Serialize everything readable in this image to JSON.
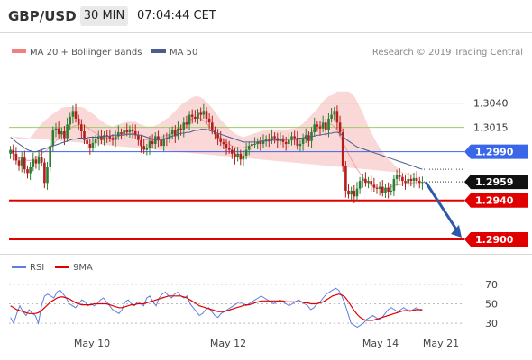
{
  "header": {
    "pair": "GBP/USD",
    "timeframe": "30 MIN",
    "time": "07:04:44 CET"
  },
  "legend": {
    "bollinger_label": "MA 20 + Bollinger Bands",
    "ma50_label": "MA 50",
    "copyright": "Research © 2019 Trading Central",
    "rsi_label": "RSI",
    "rsi_ma_label": "9MA"
  },
  "colors": {
    "bull": "#2e7d32",
    "bear": "#b71c1c",
    "band_fill": "#fad4d4",
    "band_line": "#f08080",
    "ma50": "#4a5e8c",
    "support": "#e00000",
    "pivot": "#3a66e8",
    "resistance": "#9ccc65",
    "last_price": "#111111",
    "rsi": "#5b7fe0",
    "rsi_ma": "#e00000"
  },
  "chart_data": [
    {
      "type": "candlestick",
      "title": "GBP/USD",
      "timeframe": "30 MIN",
      "x_ticks": [
        "May 10",
        "May 12",
        "May 14",
        "May 21"
      ],
      "ylim": [
        1.2887,
        1.3085
      ],
      "levels": [
        {
          "value": 1.304,
          "label": "1.3040",
          "kind": "resistance"
        },
        {
          "value": 1.3015,
          "label": "1.3015",
          "kind": "resistance"
        },
        {
          "value": 1.299,
          "label": "1.2990",
          "kind": "pivot"
        },
        {
          "value": 1.2959,
          "label": "1.2959",
          "kind": "last"
        },
        {
          "value": 1.294,
          "label": "1.2940",
          "kind": "support"
        },
        {
          "value": 1.29,
          "label": "1.2900",
          "kind": "support"
        }
      ],
      "forecast": {
        "from": 1.2959,
        "to": 1.29
      },
      "close_series": [
        1.2992,
        1.2988,
        1.2981,
        1.2976,
        1.2984,
        1.2972,
        1.2968,
        1.2974,
        1.2982,
        1.2978,
        1.2985,
        1.2979,
        1.2958,
        1.2974,
        1.2996,
        1.3012,
        1.3014,
        1.3008,
        1.3011,
        1.3004,
        1.3018,
        1.3026,
        1.3032,
        1.3024,
        1.3018,
        1.3011,
        1.3002,
        1.2998,
        1.2994,
        1.2999,
        1.3003,
        1.3006,
        1.3002,
        1.3007,
        1.3006,
        1.3004,
        1.3002,
        1.3006,
        1.301,
        1.3008,
        1.3012,
        1.301,
        1.3013,
        1.3011,
        1.3007,
        1.3002,
        1.2996,
        1.2992,
        1.2994,
        1.3001,
        1.2998,
        1.3006,
        1.3002,
        1.2996,
        1.3004,
        1.3003,
        1.3008,
        1.3012,
        1.3006,
        1.3014,
        1.3012,
        1.302,
        1.3018,
        1.3028,
        1.3026,
        1.3024,
        1.303,
        1.3028,
        1.3032,
        1.3024,
        1.302,
        1.3012,
        1.3008,
        1.3004,
        1.3,
        1.2998,
        1.2994,
        1.2992,
        1.2988,
        1.2984,
        1.2988,
        1.2982,
        1.2986,
        1.2992,
        1.2996,
        1.2998,
        1.2998,
        1.3,
        1.2998,
        1.3001,
        1.3003,
        1.3002,
        1.3006,
        1.3004,
        1.3001,
        1.3003,
        1.3,
        1.2998,
        1.3002,
        1.3006,
        1.3004,
        1.2996,
        1.2998,
        1.3003,
        1.3007,
        1.3001,
        1.301,
        1.3018,
        1.3016,
        1.3014,
        1.302,
        1.3012,
        1.3024,
        1.3028,
        1.3032,
        1.302,
        1.301,
        1.2975,
        1.295,
        1.2946,
        1.295,
        1.2944,
        1.2952,
        1.296,
        1.2962,
        1.2958,
        1.296,
        1.2956,
        1.2953,
        1.2952,
        1.2954,
        1.2948,
        1.2953,
        1.2949,
        1.295,
        1.2962,
        1.2966,
        1.2964,
        1.296,
        1.2958,
        1.2962,
        1.296,
        1.2963,
        1.296,
        1.2958,
        1.2959
      ],
      "ma50_series": [
        1.3005,
        1.3003,
        1.3,
        1.2998,
        1.2996,
        1.2994,
        1.2992,
        1.2991,
        1.299,
        1.299,
        1.2991,
        1.2992,
        1.2993,
        1.2994,
        1.2995,
        1.2996,
        1.2997,
        1.2998,
        1.2999,
        1.3,
        1.3001,
        1.3002,
        1.3003,
        1.3003,
        1.3004,
        1.3004,
        1.3004,
        1.3004,
        1.3005,
        1.3005,
        1.3005,
        1.3005,
        1.3006,
        1.3006,
        1.3006,
        1.3006,
        1.3007,
        1.3007,
        1.3007,
        1.3007,
        1.3007,
        1.3008,
        1.3008,
        1.3008,
        1.3008,
        1.3007,
        1.3007,
        1.3006,
        1.3005,
        1.3004,
        1.3003,
        1.3002,
        1.3002,
        1.3002,
        1.3003,
        1.3004,
        1.3005,
        1.3006,
        1.3007,
        1.3008,
        1.3009,
        1.3009,
        1.301,
        1.301,
        1.3011,
        1.3012,
        1.3012,
        1.3013,
        1.3013,
        1.3013,
        1.3012,
        1.3011,
        1.301,
        1.3009,
        1.3008,
        1.3007,
        1.3006,
        1.3005,
        1.3004,
        1.3003,
        1.3002,
        1.3001,
        1.3,
        1.3,
        1.3,
        1.3,
        1.3,
        1.3,
        1.3001,
        1.3001,
        1.3001,
        1.3001,
        1.3002,
        1.3002,
        1.3002,
        1.3002,
        1.3003,
        1.3003,
        1.3003,
        1.3003,
        1.3003,
        1.3004,
        1.3004,
        1.3004,
        1.3005,
        1.3005,
        1.3006,
        1.3006,
        1.3007,
        1.3007,
        1.3008,
        1.3008,
        1.3009,
        1.3009,
        1.301,
        1.301,
        1.3009,
        1.3006,
        1.3003,
        1.3001,
        1.2999,
        1.2997,
        1.2995,
        1.2994,
        1.2993,
        1.2992,
        1.2991,
        1.299,
        1.2989,
        1.2988,
        1.2987,
        1.2986,
        1.2985,
        1.2984,
        1.2983,
        1.2982,
        1.2981,
        1.298,
        1.2979,
        1.2978,
        1.2977,
        1.2976,
        1.2975,
        1.2974,
        1.2973,
        1.2972
      ],
      "bb_mid_series": [
        1.299,
        1.2988,
        1.2986,
        1.2984,
        1.2983,
        1.2982,
        1.2981,
        1.2981,
        1.2982,
        1.2984,
        1.2986,
        1.2988,
        1.299,
        1.2992,
        1.2995,
        1.2998,
        1.3001,
        1.3004,
        1.3007,
        1.301,
        1.3012,
        1.3014,
        1.3016,
        1.3017,
        1.3018,
        1.3018,
        1.3017,
        1.3015,
        1.3013,
        1.3011,
        1.3009,
        1.3007,
        1.3006,
        1.3005,
        1.3004,
        1.3004,
        1.3004,
        1.3005,
        1.3006,
        1.3007,
        1.3008,
        1.3009,
        1.3009,
        1.3009,
        1.3008,
        1.3006,
        1.3004,
        1.3003,
        1.3002,
        1.3002,
        1.3002,
        1.3003,
        1.3004,
        1.3005,
        1.3006,
        1.3007,
        1.3008,
        1.301,
        1.3012,
        1.3014,
        1.3016,
        1.3018,
        1.302,
        1.3022,
        1.3024,
        1.3025,
        1.3025,
        1.3024,
        1.3022,
        1.3019,
        1.3016,
        1.3013,
        1.301,
        1.3007,
        1.3004,
        1.3002,
        1.3,
        1.2998,
        1.2996,
        1.2995,
        1.2994,
        1.2994,
        1.2994,
        1.2995,
        1.2996,
        1.2997,
        1.2998,
        1.2999,
        1.3,
        1.3001,
        1.3001,
        1.3002,
        1.3002,
        1.3002,
        1.3002,
        1.3002,
        1.3002,
        1.3002,
        1.3002,
        1.3002,
        1.3002,
        1.3002,
        1.3003,
        1.3004,
        1.3006,
        1.3008,
        1.301,
        1.3012,
        1.3014,
        1.3016,
        1.3018,
        1.3019,
        1.3019,
        1.3018,
        1.3016,
        1.3012,
        1.3006,
        1.3,
        1.2994,
        1.2988,
        1.2982,
        1.2977,
        1.2972,
        1.2968,
        1.2964,
        1.2961,
        1.2958,
        1.2956,
        1.2954,
        1.2953,
        1.2952,
        1.2952,
        1.2952,
        1.2953,
        1.2954,
        1.2955,
        1.2956,
        1.2956,
        1.2957,
        1.2957,
        1.2958,
        1.2958,
        1.2958,
        1.2959
      ],
      "bb_width_series": [
        0.0016,
        0.0017,
        0.0018,
        0.0019,
        0.002,
        0.0021,
        0.0022,
        0.0024,
        0.0026,
        0.0028,
        0.003,
        0.0031,
        0.0032,
        0.0032,
        0.0032,
        0.0031,
        0.003,
        0.0029,
        0.0028,
        0.0026,
        0.0024,
        0.0022,
        0.002,
        0.0019,
        0.0018,
        0.0018,
        0.0018,
        0.0018,
        0.0018,
        0.0018,
        0.0018,
        0.0017,
        0.0016,
        0.0015,
        0.0014,
        0.0013,
        0.0012,
        0.0012,
        0.0012,
        0.0012,
        0.0012,
        0.0012,
        0.0012,
        0.0012,
        0.0013,
        0.0013,
        0.0014,
        0.0014,
        0.0014,
        0.0014,
        0.0014,
        0.0014,
        0.0014,
        0.0015,
        0.0016,
        0.0017,
        0.0018,
        0.0019,
        0.002,
        0.0021,
        0.0022,
        0.0022,
        0.0022,
        0.0022,
        0.0022,
        0.0022,
        0.0022,
        0.0022,
        0.0022,
        0.0022,
        0.0022,
        0.0022,
        0.0021,
        0.002,
        0.0019,
        0.0018,
        0.0017,
        0.0016,
        0.0015,
        0.0014,
        0.0013,
        0.0012,
        0.0011,
        0.0011,
        0.0011,
        0.0011,
        0.0011,
        0.0011,
        0.0011,
        0.0011,
        0.0011,
        0.0011,
        0.0011,
        0.0011,
        0.0011,
        0.0011,
        0.0011,
        0.0011,
        0.0011,
        0.0012,
        0.0012,
        0.0013,
        0.0014,
        0.0015,
        0.0016,
        0.0017,
        0.0018,
        0.0019,
        0.002,
        0.0022,
        0.0024,
        0.0026,
        0.0028,
        0.003,
        0.0034,
        0.004,
        0.0046,
        0.0052,
        0.0058,
        0.0064,
        0.0068,
        0.007,
        0.007,
        0.0068,
        0.0066,
        0.0062,
        0.0058,
        0.0054,
        0.005,
        0.0046,
        0.0042,
        0.0038,
        0.0034,
        0.003,
        0.0026,
        0.0022,
        0.0018,
        0.0015,
        0.0012,
        0.001,
        0.0008,
        0.0008,
        0.0008,
        0.0008
      ]
    },
    {
      "type": "line",
      "title": "RSI",
      "yticks": [
        70,
        50,
        30
      ],
      "ylim": [
        20,
        80
      ],
      "series": [
        {
          "name": "RSI",
          "values": [
            36,
            30,
            40,
            48,
            42,
            38,
            44,
            40,
            38,
            30,
            48,
            58,
            60,
            58,
            56,
            62,
            64,
            60,
            56,
            50,
            48,
            46,
            50,
            54,
            52,
            48,
            50,
            48,
            50,
            54,
            56,
            52,
            48,
            44,
            42,
            40,
            44,
            52,
            54,
            50,
            48,
            52,
            50,
            48,
            56,
            58,
            52,
            48,
            56,
            60,
            62,
            58,
            56,
            60,
            62,
            58,
            56,
            58,
            50,
            46,
            42,
            38,
            40,
            44,
            46,
            42,
            38,
            36,
            40,
            42,
            44,
            46,
            48,
            50,
            52,
            50,
            48,
            50,
            52,
            54,
            56,
            58,
            56,
            54,
            52,
            50,
            52,
            54,
            52,
            50,
            48,
            50,
            52,
            54,
            52,
            50,
            48,
            44,
            46,
            50,
            52,
            56,
            60,
            62,
            64,
            66,
            64,
            58,
            50,
            40,
            30,
            28,
            26,
            28,
            30,
            34,
            36,
            38,
            36,
            34,
            36,
            40,
            44,
            46,
            44,
            42,
            44,
            46,
            44,
            42,
            44,
            46,
            44,
            43
          ]
        },
        {
          "name": "9MA",
          "values": [
            48,
            46,
            44,
            43,
            42,
            41,
            40,
            40,
            40,
            41,
            43,
            46,
            49,
            52,
            54,
            56,
            57,
            57,
            56,
            55,
            53,
            51,
            50,
            49,
            49,
            49,
            49,
            50,
            50,
            50,
            50,
            50,
            49,
            48,
            47,
            46,
            46,
            47,
            48,
            49,
            49,
            50,
            50,
            50,
            51,
            52,
            53,
            54,
            55,
            56,
            57,
            58,
            58,
            58,
            58,
            58,
            57,
            56,
            54,
            52,
            50,
            48,
            47,
            46,
            45,
            44,
            43,
            42,
            42,
            42,
            43,
            44,
            45,
            46,
            47,
            48,
            49,
            49,
            50,
            51,
            52,
            53,
            53,
            53,
            53,
            53,
            53,
            53,
            53,
            52,
            52,
            52,
            52,
            52,
            52,
            51,
            51,
            50,
            50,
            50,
            51,
            52,
            54,
            56,
            58,
            59,
            60,
            59,
            57,
            53,
            48,
            43,
            39,
            36,
            34,
            33,
            33,
            33,
            34,
            35,
            36,
            37,
            38,
            39,
            40,
            41,
            42,
            43,
            43,
            43,
            43,
            44,
            44,
            44
          ]
        }
      ]
    }
  ]
}
